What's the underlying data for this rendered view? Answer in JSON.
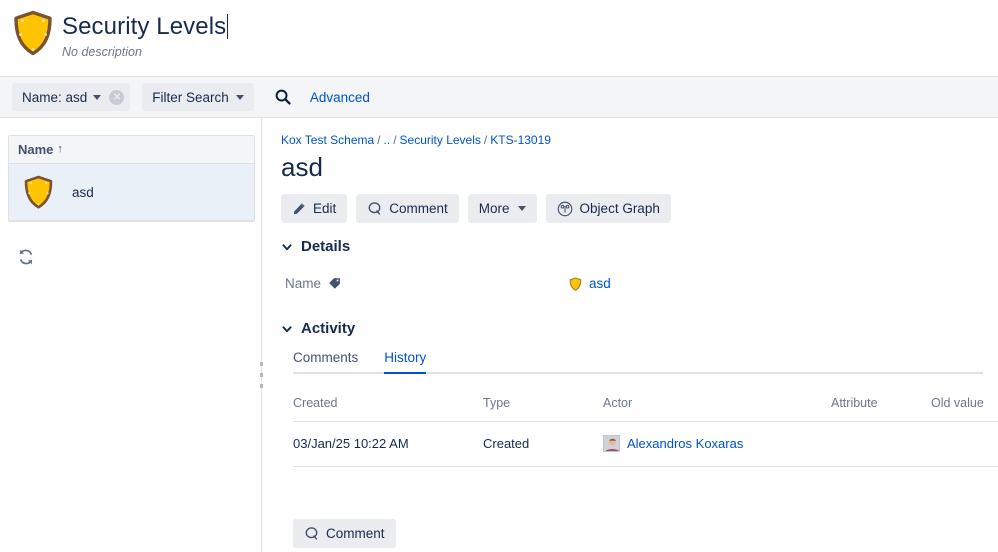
{
  "header": {
    "icon": "shield-icon",
    "title": "Security Levels",
    "description": "No description"
  },
  "toolbar": {
    "filter_pill": {
      "label": "Name: asd",
      "clear_icon": "clear-circle-icon",
      "caret_icon": "chevron-down-icon"
    },
    "filter_search": {
      "label": "Filter Search",
      "caret_icon": "chevron-down-icon"
    },
    "search_icon": "search-icon",
    "advanced_link": "Advanced"
  },
  "sidebar": {
    "column_header": "Name",
    "sort_arrow": "↑",
    "rows": [
      {
        "icon": "shield-icon",
        "label": "asd",
        "selected": true
      }
    ],
    "refresh_icon": "refresh-icon"
  },
  "drag_handle": "panel-resize-handle",
  "main": {
    "breadcrumb": [
      {
        "text": "Kox Test Schema",
        "link": true
      },
      {
        "text": "..",
        "link": false
      },
      {
        "text": "Security Levels",
        "link": true
      },
      {
        "text": "KTS-13019",
        "link": true
      }
    ],
    "breadcrumb_separator": "/",
    "object_title": "asd",
    "actions": [
      {
        "label": "Edit",
        "icon": "pencil-icon"
      },
      {
        "label": "Comment",
        "icon": "comment-icon"
      },
      {
        "label": "More",
        "icon": "chevron-down-icon"
      },
      {
        "label": "Object Graph",
        "icon": "object-graph-icon"
      }
    ],
    "details": {
      "heading": "Details",
      "chevron": "chevron-down-icon",
      "rows": [
        {
          "label": "Name",
          "label_icon": "tag-icon",
          "value": "asd",
          "value_icon": "shield-icon"
        }
      ]
    },
    "activity": {
      "heading": "Activity",
      "chevron": "chevron-down-icon",
      "tabs": [
        {
          "label": "Comments",
          "active": false
        },
        {
          "label": "History",
          "active": true
        }
      ],
      "history": {
        "columns": [
          "Created",
          "Type",
          "Actor",
          "Attribute",
          "Old value"
        ],
        "rows": [
          {
            "created": "03/Jan/25 10:22 AM",
            "type": "Created",
            "actor": "Alexandros Koxaras",
            "actor_avatar": "user-avatar",
            "attribute": "",
            "old_value": ""
          }
        ]
      },
      "comment_button": {
        "label": "Comment",
        "icon": "comment-icon"
      }
    }
  },
  "colors": {
    "accent_link": "#0052cc",
    "shield_fill": "#ffc400",
    "shield_stroke": "#7a5232",
    "selected_row": "#e9f0f7",
    "toolbar_bg": "#f4f5f7",
    "button_bg": "#ebecf0",
    "border": "#dfe1e6",
    "muted_text": "#6b778c"
  }
}
